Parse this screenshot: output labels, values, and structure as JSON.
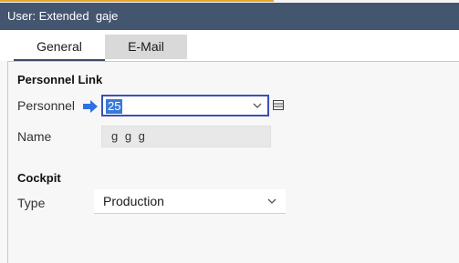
{
  "window": {
    "title": "User: Extended  gaje"
  },
  "tabs": [
    {
      "label": "General",
      "active": true
    },
    {
      "label": "E-Mail",
      "active": false
    }
  ],
  "personnel_link": {
    "heading": "Personnel Link",
    "personnel_label": "Personnel",
    "personnel_value": "25",
    "name_label": "Name",
    "name_value": "g g g"
  },
  "cockpit": {
    "heading": "Cockpit",
    "type_label": "Type",
    "type_value": "Production"
  },
  "icons": {
    "personnel_marker": "right-arrow-icon",
    "personnel_dropdown": "chevron-down-icon",
    "personnel_list": "list-icon",
    "type_dropdown": "chevron-down-icon"
  },
  "colors": {
    "titlebar": "#445570",
    "accent_line": "#e8a92b",
    "arrow": "#2f6fe0",
    "focus_border": "#3a50b8",
    "selection": "#3a79d8"
  }
}
